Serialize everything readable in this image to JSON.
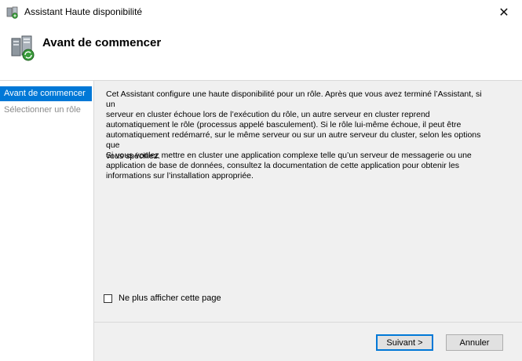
{
  "window": {
    "title": "Assistant Haute disponibilité",
    "close_glyph": "✕",
    "app_icon": "cluster-wizard-icon"
  },
  "header": {
    "title": "Avant de commencer",
    "icon": "cluster-servers-icon"
  },
  "sidebar": {
    "items": [
      {
        "label": "Avant de commencer",
        "state": "active"
      },
      {
        "label": "Sélectionner un rôle",
        "state": "inactive"
      }
    ]
  },
  "main": {
    "paragraph1_lines": [
      "Cet Assistant configure une haute disponibilité pour un rôle. Après que vous avez terminé l’Assistant, si un",
      "serveur en cluster échoue lors de l’exécution du rôle, un autre serveur en cluster reprend",
      "automatiquement le rôle (processus appelé basculement). Si le rôle lui-même échoue, il peut être",
      "automatiquement redémarré, sur le même serveur ou sur un autre serveur du cluster, selon les options que",
      "vous spécifiez."
    ],
    "paragraph2_lines": [
      "Si vous voulez mettre en cluster une application complexe telle qu’un serveur de messagerie ou une",
      "application de base de données, consultez la documentation de cette application pour obtenir les",
      "informations sur l’installation appropriée."
    ],
    "checkbox": {
      "label": "Ne plus afficher cette page",
      "checked": false
    }
  },
  "footer": {
    "next_label": "Suivant >",
    "cancel_label": "Annuler"
  },
  "colors": {
    "accent": "#0078d7",
    "panel": "#f0f0f0",
    "inactive_text": "#8a8a8a"
  }
}
